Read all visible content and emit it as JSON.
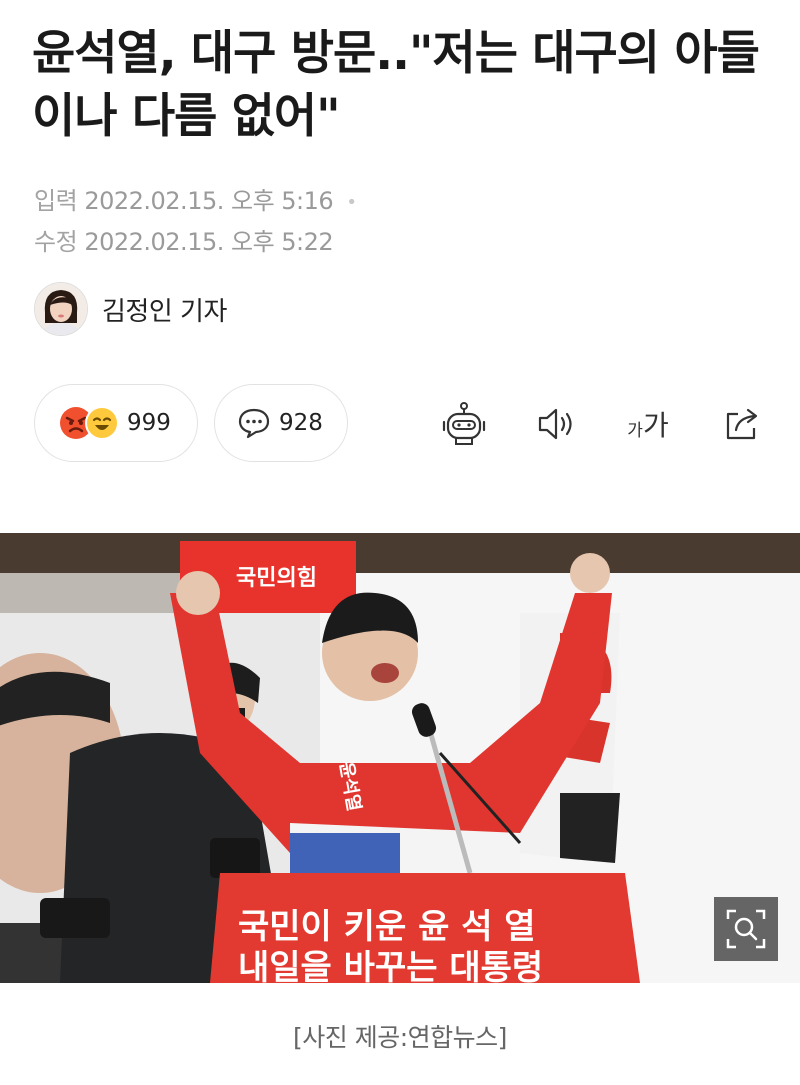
{
  "article": {
    "headline": "윤석열, 대구 방문..\"저는 대구의 아들이나 다름 없어\"",
    "published_label": "입력",
    "published_time": "2022.02.15. 오후 5:16",
    "modified_label": "수정",
    "modified_time": "2022.02.15. 오후 5:22",
    "author": "김정인 기자"
  },
  "reactions": {
    "count": "999",
    "comment_count": "928"
  },
  "toolbar": {
    "font_size_small": "가",
    "font_size_large": "가"
  },
  "photo": {
    "party_sign": "국민의힘",
    "podium_line1": "국민이 키운 윤 석 열",
    "podium_line2": "내일을 바꾸는 대통령",
    "jacket_text": "윤석열",
    "caption": "[사진 제공:연합뉴스]"
  },
  "colors": {
    "accent_red": "#e8322c",
    "meta_gray": "#9a9a9a"
  }
}
